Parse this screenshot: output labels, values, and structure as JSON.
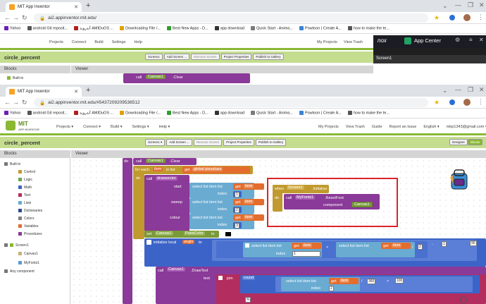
{
  "back_window": {
    "tab_title": "MIT App Inventor",
    "url": "ai2.appinventor.mit.edu/",
    "bookmarks": [
      "Yahoo",
      "android Git reposit...",
      "أندرويد AMIDuOS ...",
      "Downloading File /...",
      "Best New Apps - D...",
      "app download",
      "Quick Start - Anima...",
      "Powtoon | Create A...",
      "how to make the te..."
    ],
    "menu": [
      "Projects",
      "Connect",
      "Build",
      "Settings",
      "Help"
    ],
    "right_menu": [
      "My Projects",
      "View Trash"
    ],
    "project_name": "circle_percent",
    "buttons": [
      "Screen1",
      "Add Screen ...",
      "Remove Screen",
      "Project Properties",
      "Publish to Gallery"
    ],
    "blocks_header": "Blocks",
    "viewer_header": "Viewer",
    "builtin": "Built-in",
    "code_call": "call",
    "code_canvas": "Canvas1",
    "code_method": ".Clear"
  },
  "nox": {
    "logo": "nox",
    "app_center": "App Center",
    "screen_label": "Screen1"
  },
  "front_window": {
    "tab_title": "MIT App Inventor",
    "url": "ai2.appinventor.mit.edu/#5437209209536512",
    "bookmarks": [
      "Yahoo",
      "android Git reposit...",
      "أندرويد AMIDuOS ...",
      "Downloading File /...",
      "Best New Apps - D...",
      "app download",
      "Quick Start - Anima...",
      "Powtoon | Create A...",
      "how to make the te..."
    ],
    "logo_top": "MIT",
    "logo_bottom": "APP INVENTOR",
    "menu": [
      "Projects",
      "Connect",
      "Build",
      "Settings",
      "Help"
    ],
    "right_menu": [
      "My Projects",
      "View Trash",
      "Guide",
      "Report an Issue",
      "English",
      "mbp1343@gmail.com"
    ],
    "project_name": "circle_percent",
    "buttons": [
      "Screen1",
      "Add Screen ...",
      "Remove Screen",
      "Project Properties",
      "Publish to Gallery"
    ],
    "designer": "Designer",
    "blocks_btn": "Blocks",
    "blocks_header": "Blocks",
    "viewer_header": "Viewer",
    "tree": {
      "builtin": "Built-in",
      "categories": [
        "Control",
        "Logic",
        "Math",
        "Text",
        "Lists",
        "Dictionaries",
        "Colors",
        "Variables",
        "Procedures"
      ],
      "screen": "Screen1",
      "components": [
        "Canvas1",
        "MyFonts1"
      ],
      "any": "Any component"
    },
    "colors": {
      "control": "#c09a2e",
      "list": "#6aabd2",
      "variable": "#e46c2d",
      "math": "#3c64c8",
      "component": "#7a9a3a",
      "purple": "#8a3a98",
      "highlight": "#d9252a",
      "green_top": "#8ab833",
      "green_bar": "#c4dd8f"
    },
    "code": {
      "do": "do",
      "call": "call",
      "canvas1": "Canvas1",
      "clear": ".Clear",
      "for_each": "for each",
      "item": "item",
      "in_list": "in list",
      "get": "get",
      "global_pievalues": "global pievalues",
      "drawsector": "drawsector",
      "start": "start",
      "sweep": "sweep",
      "colour": "colour",
      "select_list_item": "select list item  list",
      "index": "index",
      "n1": "1",
      "n2": "2",
      "n3": "3",
      "set": "set",
      "paint_color": "PaintColor",
      "to": "to",
      "init_local": "initialize local",
      "angle": "angle",
      "slash": "/",
      "minus": "-",
      "n90": "90",
      "in": "in",
      "drawtext": ".DrawText",
      "text": "text",
      "join": "join",
      "round": "round",
      "n360": "360",
      "n100": "100",
      "pct": "%",
      "when": "when",
      "screen1": "Screen1",
      "initialize": ".Initialize",
      "myfonts1": "MyFonts1",
      "resetfont": ".ResetFont",
      "component": "component"
    }
  }
}
